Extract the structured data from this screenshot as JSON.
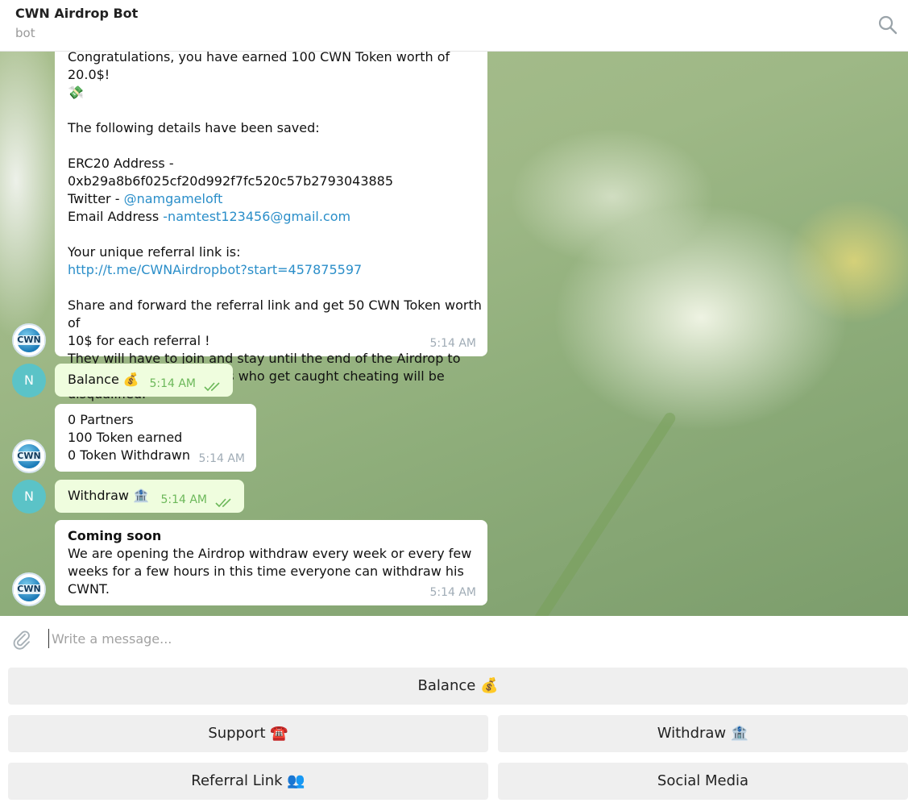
{
  "header": {
    "title": "CWN Airdrop Bot",
    "subtitle": "bot"
  },
  "messages": {
    "m1": {
      "line1": "Congratulations, you have earned 100 CWN Token worth of 20.0$!",
      "line2": "💸",
      "saved": "The following details have been saved:",
      "erc20": "ERC20 Address - 0xb29a8b6f025cf20d992f7fc520c57b2793043885",
      "twitter_label": "Twitter - ",
      "twitter_handle": "@namgameloft",
      "email_label": "Email Address ",
      "email_value": "-namtest123456@gmail.com",
      "ref_label": "Your unique referral link is:",
      "ref_link": "http://t.me/CWNAirdropbot?start=457875597",
      "share1": "Share and forward the referral link and get 50 CWN Token worth of",
      "share2": "10$ for each referral !",
      "join1": "They will have to join and stay until the end of the Airdrop to",
      "join2": "receive the reward! Users who get caught cheating will be",
      "join3": "disqualified.",
      "time": "5:14 AM"
    },
    "m2": {
      "text": "Balance 💰",
      "time": "5:14 AM"
    },
    "m3": {
      "line1": "0 Partners",
      "line2": "100 Token earned",
      "line3": "0 Token Withdrawn",
      "time": "5:14 AM"
    },
    "m4": {
      "text": "Withdraw 🏦",
      "time": "5:14 AM"
    },
    "m5": {
      "title": "Coming soon",
      "line1": "We are opening the Airdrop withdraw every week or every few",
      "line2": "weeks for a few hours in this time everyone can withdraw his",
      "line3": "CWNT.",
      "time": "5:14 AM"
    }
  },
  "avatars": {
    "user": "N",
    "bot": "CWN"
  },
  "composer": {
    "placeholder": "Write a message..."
  },
  "keyboard": {
    "balance": "Balance 💰",
    "support": "Support ☎️",
    "withdraw": "Withdraw 🏦",
    "referral": "Referral Link 👥",
    "social": "Social Media"
  },
  "colors": {
    "outgoing_bubble": "#effdde",
    "link": "#2a8ec9",
    "user_avatar": "#5bc3c7",
    "read_check": "#6cb85a"
  }
}
